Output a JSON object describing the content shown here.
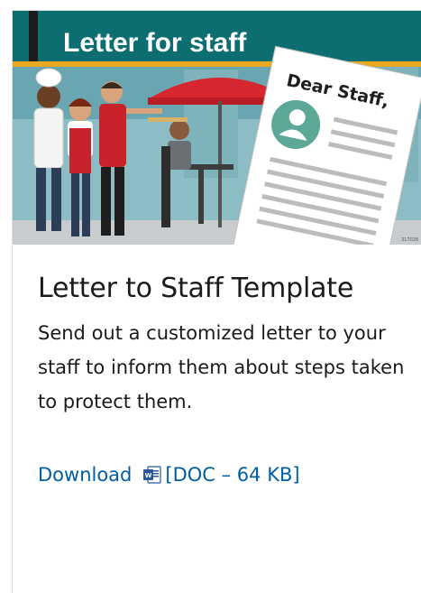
{
  "hero": {
    "banner_text": "Letter for staff",
    "letter_greeting": "Dear Staff,",
    "image_code": "317028",
    "colors": {
      "banner": "#0d6e72",
      "accent": "#e9a920",
      "background": "#5d9aa5"
    }
  },
  "card": {
    "title": "Letter to Staff Template",
    "description": "Send out a customized letter to your staff to inform them about steps taken to protect them.",
    "download_label": "Download",
    "file_info": "[DOC – 64 KB]",
    "file_icon": "word-doc-icon",
    "link_color": "#005ea2"
  }
}
